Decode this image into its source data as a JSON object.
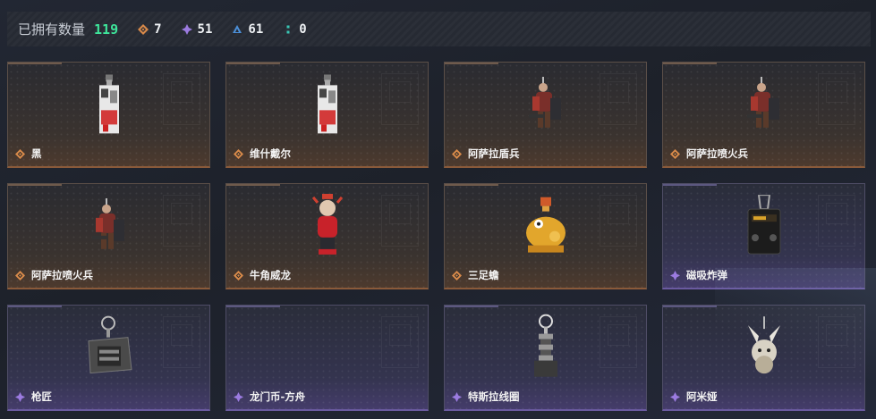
{
  "header": {
    "label": "已拥有数量",
    "total": "119",
    "counts": [
      {
        "icon": "orange-diamond-icon",
        "color": "#d98a4a",
        "value": "7"
      },
      {
        "icon": "purple-diamond-icon",
        "color": "#9b7be0",
        "value": "51"
      },
      {
        "icon": "blue-triangle-icon",
        "color": "#4b8fd8",
        "value": "61"
      },
      {
        "icon": "teal-dots-icon",
        "color": "#39c7b5",
        "value": "0"
      }
    ]
  },
  "rarity_colors": {
    "orange": "#d98a4a",
    "purple": "#9b7be0"
  },
  "items": [
    {
      "name": "黑",
      "rarity": "orange",
      "art": "tag"
    },
    {
      "name": "维什戴尔",
      "rarity": "orange",
      "art": "tag"
    },
    {
      "name": "阿萨拉盾兵",
      "rarity": "orange",
      "art": "figure"
    },
    {
      "name": "阿萨拉喷火兵",
      "rarity": "orange",
      "art": "figure"
    },
    {
      "name": "阿萨拉喷火兵",
      "rarity": "orange",
      "art": "figure"
    },
    {
      "name": "牛角威龙",
      "rarity": "orange",
      "art": "redfigure"
    },
    {
      "name": "三足蟾",
      "rarity": "orange",
      "art": "toad"
    },
    {
      "name": "磁吸炸弹",
      "rarity": "purple",
      "art": "bomb"
    },
    {
      "name": "枪匠",
      "rarity": "purple",
      "art": "box"
    },
    {
      "name": "龙门币-方舟",
      "rarity": "purple",
      "art": "none"
    },
    {
      "name": "特斯拉线圈",
      "rarity": "purple",
      "art": "coil"
    },
    {
      "name": "阿米娅",
      "rarity": "purple",
      "art": "bunny"
    }
  ]
}
